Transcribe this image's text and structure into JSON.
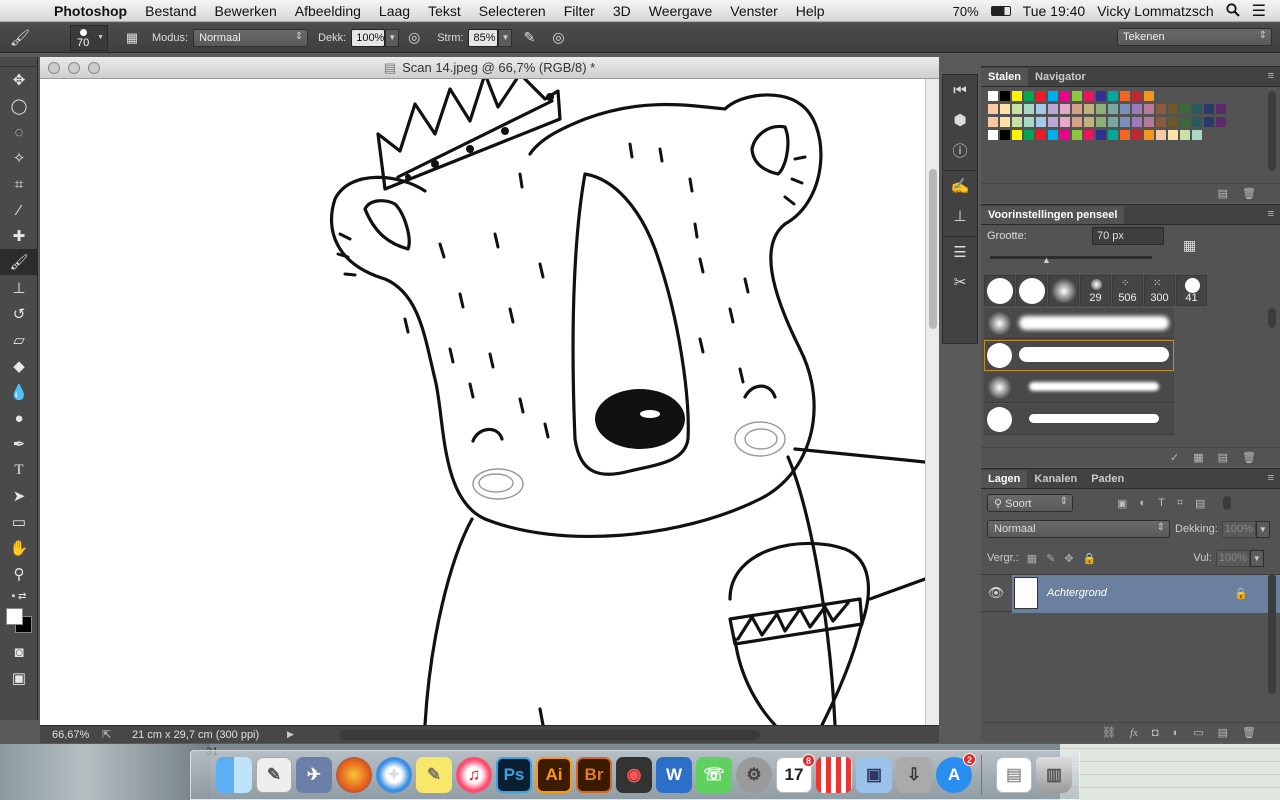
{
  "menubar": {
    "app_name": "Photoshop",
    "items": [
      "Bestand",
      "Bewerken",
      "Afbeelding",
      "Laag",
      "Tekst",
      "Selecteren",
      "Filter",
      "3D",
      "Weergave",
      "Venster",
      "Help"
    ],
    "battery": "70%",
    "clock": "Tue 19:40",
    "user": "Vicky Lommatzsch"
  },
  "options": {
    "brush_size": "70",
    "mode_label": "Modus:",
    "mode_value": "Normaal",
    "opacity_label": "Dekk:",
    "opacity_value": "100%",
    "flow_label": "Strm:",
    "flow_value": "85%",
    "workspace": "Tekenen"
  },
  "document": {
    "title": "Scan 14.jpeg @ 66,7% (RGB/8) *",
    "zoom": "66,67%",
    "size": "21 cm x 29,7 cm (300 ppi)"
  },
  "swatches_panel": {
    "tabs": [
      "Stalen",
      "Navigator"
    ],
    "colors": [
      "#ffffff",
      "#000000",
      "#fff200",
      "#00a651",
      "#ed1c24",
      "#00aeef",
      "#ec008c",
      "#8dc63f",
      "#ed145b",
      "#2e3192",
      "#00a99d",
      "#f26522",
      "#c1272d",
      "#f7941d"
    ]
  },
  "brush_panel": {
    "title": "Voorinstellingen penseel",
    "size_label": "Grootte:",
    "size_value": "70 px",
    "presets": [
      "29",
      "506",
      "300",
      "41"
    ]
  },
  "layers_panel": {
    "tabs": [
      "Lagen",
      "Kanalen",
      "Paden"
    ],
    "filter": "Soort",
    "blend_mode": "Normaal",
    "opacity_label": "Dekking:",
    "opacity_value": "100%",
    "lock_label": "Vergr.:",
    "fill_label": "Vul:",
    "fill_value": "100%",
    "layer_name": "Achtergrond"
  },
  "dock": {
    "ps_label": "Ps",
    "ai_label": "Ai",
    "br_label": "Br",
    "calendar_day": "17",
    "calendar_badge": "8",
    "appstore_badge": "2",
    "bg_number": "31"
  }
}
